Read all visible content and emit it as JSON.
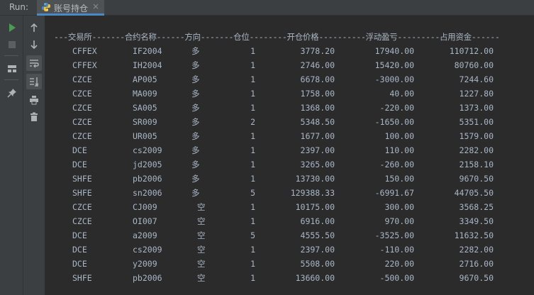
{
  "run_label": "Run:",
  "tab": {
    "title": "账号持仓",
    "close": "×"
  },
  "toolbar_left": [
    {
      "name": "run-icon",
      "color": "#499c54"
    },
    {
      "name": "stop-icon",
      "color": "#5e5e5e"
    },
    {
      "name": "layout-icon",
      "color": "#afb1b3"
    },
    {
      "name": "pin-icon",
      "color": "#afb1b3"
    }
  ],
  "toolbar_right": [
    {
      "name": "up-arrow-icon"
    },
    {
      "name": "down-arrow-icon"
    },
    {
      "name": "soft-wrap-icon"
    },
    {
      "name": "scroll-to-end-icon"
    },
    {
      "name": "print-icon"
    },
    {
      "name": "trash-icon"
    }
  ],
  "header_line": "---交易所-------合约名称------方向-------仓位--------开仓价格----------浮动盈亏---------占用资金------",
  "rows": [
    {
      "exchange": "CFFEX",
      "contract": "IF2004",
      "direction": "多",
      "position": "1",
      "open_price": "3778.20",
      "float_pnl": "17940.00",
      "margin": "110712.00"
    },
    {
      "exchange": "CFFEX",
      "contract": "IH2004",
      "direction": "多",
      "position": "1",
      "open_price": "2746.00",
      "float_pnl": "15420.00",
      "margin": "80760.00"
    },
    {
      "exchange": "CZCE",
      "contract": "AP005",
      "direction": "多",
      "position": "1",
      "open_price": "6678.00",
      "float_pnl": "-3000.00",
      "margin": "7244.60"
    },
    {
      "exchange": "CZCE",
      "contract": "MA009",
      "direction": "多",
      "position": "1",
      "open_price": "1758.00",
      "float_pnl": "40.00",
      "margin": "1227.80"
    },
    {
      "exchange": "CZCE",
      "contract": "SA005",
      "direction": "多",
      "position": "1",
      "open_price": "1368.00",
      "float_pnl": "-220.00",
      "margin": "1373.00"
    },
    {
      "exchange": "CZCE",
      "contract": "SR009",
      "direction": "多",
      "position": "2",
      "open_price": "5348.50",
      "float_pnl": "-1650.00",
      "margin": "5351.00"
    },
    {
      "exchange": "CZCE",
      "contract": "UR005",
      "direction": "多",
      "position": "1",
      "open_price": "1677.00",
      "float_pnl": "100.00",
      "margin": "1579.00"
    },
    {
      "exchange": "DCE",
      "contract": "cs2009",
      "direction": "多",
      "position": "1",
      "open_price": "2397.00",
      "float_pnl": "110.00",
      "margin": "2282.00"
    },
    {
      "exchange": "DCE",
      "contract": "jd2005",
      "direction": "多",
      "position": "1",
      "open_price": "3265.00",
      "float_pnl": "-260.00",
      "margin": "2158.10"
    },
    {
      "exchange": "SHFE",
      "contract": "pb2006",
      "direction": "多",
      "position": "1",
      "open_price": "13730.00",
      "float_pnl": "150.00",
      "margin": "9670.50"
    },
    {
      "exchange": "SHFE",
      "contract": "sn2006",
      "direction": "多",
      "position": "5",
      "open_price": "129388.33",
      "float_pnl": "-6991.67",
      "margin": "44705.50"
    },
    {
      "exchange": "CZCE",
      "contract": "CJ009",
      "direction": "空",
      "position": "1",
      "open_price": "10175.00",
      "float_pnl": "300.00",
      "margin": "3568.25"
    },
    {
      "exchange": "CZCE",
      "contract": "OI007",
      "direction": "空",
      "position": "1",
      "open_price": "6916.00",
      "float_pnl": "970.00",
      "margin": "3349.50"
    },
    {
      "exchange": "DCE",
      "contract": "a2009",
      "direction": "空",
      "position": "5",
      "open_price": "4555.50",
      "float_pnl": "-3525.00",
      "margin": "11632.50"
    },
    {
      "exchange": "DCE",
      "contract": "cs2009",
      "direction": "空",
      "position": "1",
      "open_price": "2397.00",
      "float_pnl": "-110.00",
      "margin": "2282.00"
    },
    {
      "exchange": "DCE",
      "contract": "y2009",
      "direction": "空",
      "position": "1",
      "open_price": "5508.00",
      "float_pnl": "220.00",
      "margin": "2716.00"
    },
    {
      "exchange": "SHFE",
      "contract": "pb2006",
      "direction": "空",
      "position": "1",
      "open_price": "13660.00",
      "float_pnl": "-500.00",
      "margin": "9670.50"
    }
  ]
}
